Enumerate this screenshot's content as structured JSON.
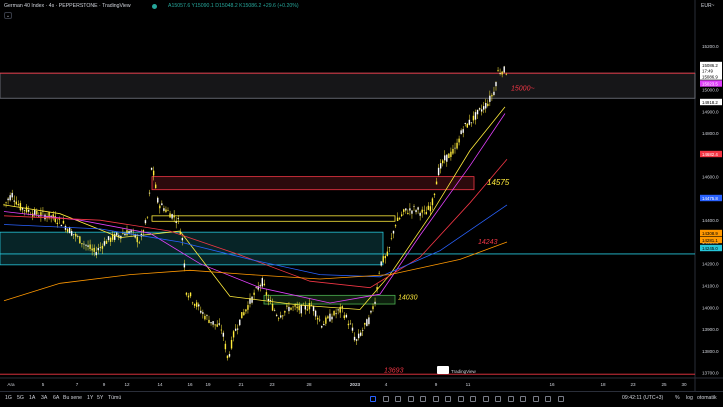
{
  "header": {
    "title": "German 40 Index · 4s · PEPPERSTONE · TradingView",
    "ohlc": "A15057.6 Y15090.1 D15048.2 K15086.2 +29.6 (+0.20%)",
    "currency": "EUR~",
    "collapse_label": "⌄"
  },
  "chart_data": {
    "type": "candlestick",
    "symbol": "German 40 Index",
    "timeframe": "4s",
    "ylim": [
      13680,
      15310
    ],
    "y_ticks": [
      15200,
      15100,
      15000,
      14900,
      14800,
      14700,
      14600,
      14500,
      14400,
      14300,
      14200,
      14100,
      14000,
      13900,
      13800,
      13700
    ],
    "x_ticks": [
      "Ara",
      "5",
      "7",
      "9",
      "12",
      "14",
      "16",
      "19",
      "21",
      "23",
      "28",
      "2023",
      "4",
      "9",
      "11",
      "16",
      "18",
      "23",
      "25",
      "30"
    ],
    "price_tags": [
      {
        "value": "15086.2",
        "color": "#ffffff",
        "text_color": "#000000"
      },
      {
        "value": "17:49",
        "color": "#ffffff",
        "text_color": "#000000"
      },
      {
        "value": "15086.9",
        "color": "#ffffff",
        "text_color": "#000000"
      },
      {
        "value": "15023.5",
        "color": "#e040fb",
        "text_color": "#ffffff"
      },
      {
        "value": "14918.2",
        "color": "#ffffff",
        "text_color": "#000000"
      },
      {
        "value": "14682.4",
        "color": "#f23645",
        "text_color": "#ffffff"
      },
      {
        "value": "14475.8",
        "color": "#2962ff",
        "text_color": "#ffffff"
      },
      {
        "value": "14308.9",
        "color": "#ff9800",
        "text_color": "#000000"
      },
      {
        "value": "14281.1",
        "color": "#ff9800",
        "text_color": "#000000"
      },
      {
        "value": "14245.0",
        "color": "#26c6da",
        "text_color": "#000000"
      }
    ],
    "annotations": [
      {
        "text": "15000~",
        "value": 15010,
        "color": "#f23645"
      },
      {
        "text": "14575",
        "value": 14575,
        "color": "#ffeb3b"
      },
      {
        "text": "14243",
        "value": 14305,
        "color": "#f23645"
      },
      {
        "text": "14030",
        "value": 14050,
        "color": "#ffeb3b"
      },
      {
        "text": "13693",
        "value": 13715,
        "color": "#f23645"
      }
    ],
    "horizontal_lines": [
      {
        "value": 15075,
        "color": "#f23645"
      },
      {
        "value": 14245,
        "color": "#26c6da"
      },
      {
        "value": 13693,
        "color": "#f23645"
      }
    ],
    "zones": [
      {
        "from": 14960,
        "to": 15075,
        "color": "#787b86"
      },
      {
        "from": 14540,
        "to": 14600,
        "color": "#f23645"
      },
      {
        "from": 14195,
        "to": 14345,
        "color": "#26c6da"
      },
      {
        "from": 14015,
        "to": 14055,
        "color": "#4caf50"
      }
    ],
    "moving_averages": [
      {
        "name": "MA1",
        "color": "#ffeb3b"
      },
      {
        "name": "MA2",
        "color": "#e040fb"
      },
      {
        "name": "MA3",
        "color": "#f23645"
      },
      {
        "name": "MA4",
        "color": "#2962ff"
      },
      {
        "name": "MA5",
        "color": "#ff9800"
      }
    ],
    "grid": false,
    "legend": "none"
  },
  "bottombar": {
    "ranges": [
      "1G",
      "5G",
      "1A",
      "3A",
      "6A",
      "Bu sene",
      "1Y",
      "5Y",
      "Tümü"
    ],
    "time": "09:42:11 (UTC+3)",
    "percent": "%",
    "log": "log",
    "auto": "otomatik"
  },
  "logo": {
    "text": "TradingView"
  }
}
